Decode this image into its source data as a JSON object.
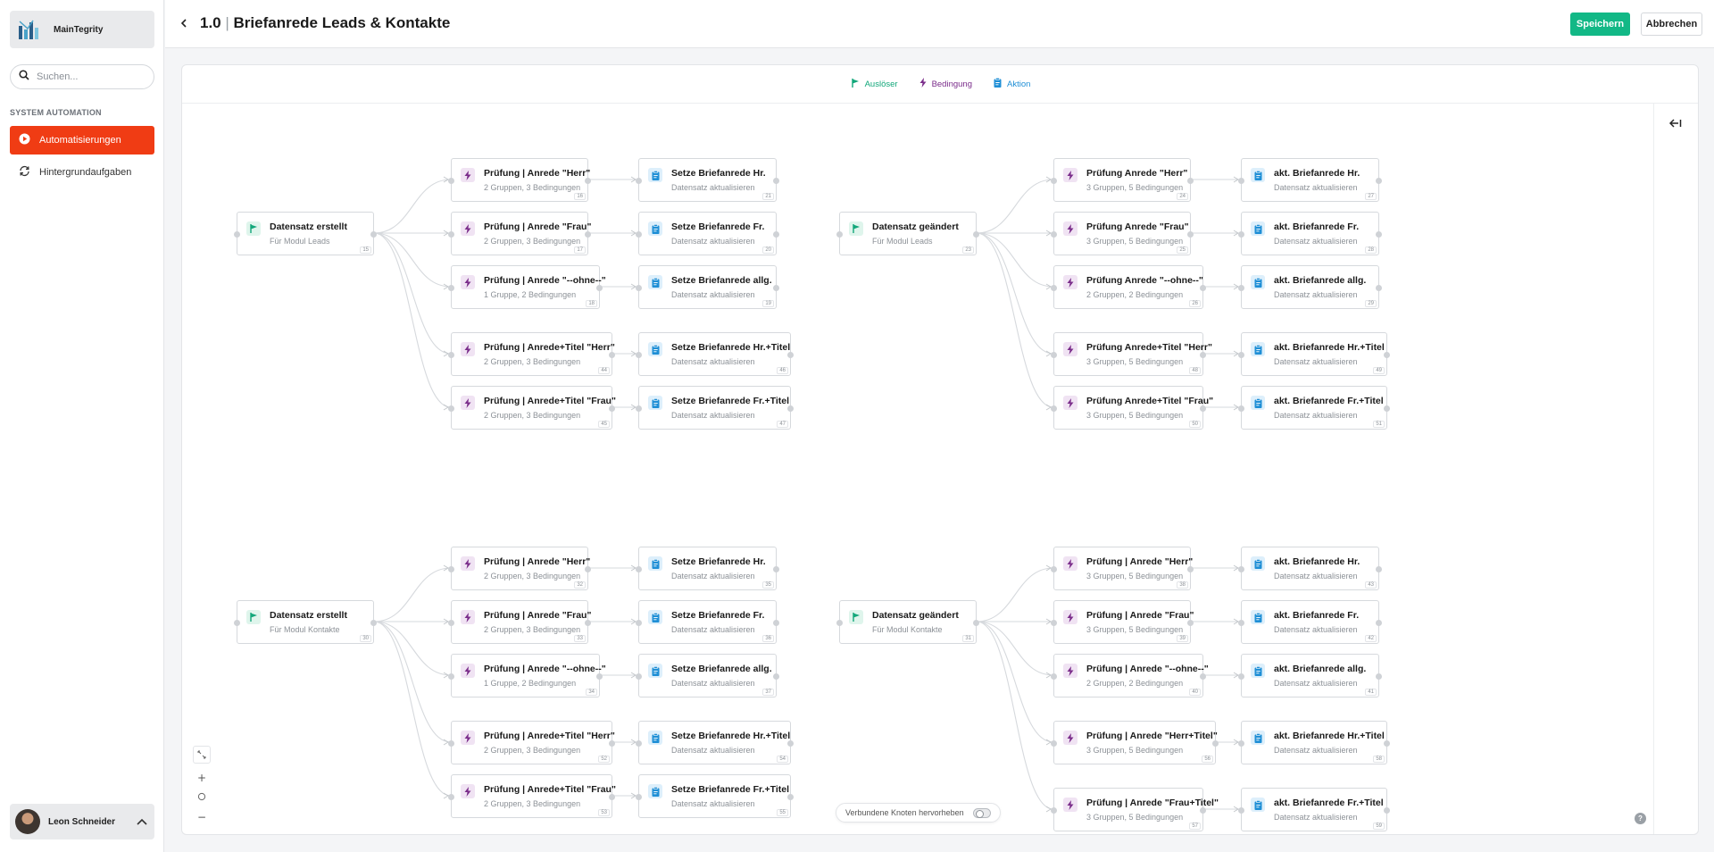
{
  "sidebar": {
    "brand": "MainTegrity",
    "search_placeholder": "Suchen...",
    "section": "SYSTEM AUTOMATION",
    "items": [
      {
        "label": "Automatisierungen",
        "active": true,
        "icon": "play-circle-icon"
      },
      {
        "label": "Hintergrundaufgaben",
        "active": false,
        "icon": "refresh-icon"
      }
    ],
    "user": "Leon Schneider"
  },
  "header": {
    "version": "1.0",
    "separator": "|",
    "title": "Briefanrede Leads & Kontakte",
    "save": "Speichern",
    "cancel": "Abbrechen"
  },
  "legend": {
    "trigger": "Auslöser",
    "condition": "Bedingung",
    "action": "Aktion"
  },
  "colors": {
    "accent": "#f03c14",
    "save": "#12b886",
    "trigger": "#12a77a",
    "condition": "#7a2c8a",
    "action": "#1f8fd6"
  },
  "highlight_label": "Verbundene Knoten hervorheben",
  "help": "?",
  "groups": [
    {
      "trigger": {
        "title": "Datensatz erstellt",
        "sub": "Für Modul Leads",
        "id": "15"
      },
      "branches": [
        {
          "cond": {
            "title": "Prüfung | Anrede \"Herr\"",
            "sub": "2 Gruppen, 3 Bedingungen",
            "id": "16"
          },
          "action": {
            "title": "Setze Briefanrede Hr.",
            "sub": "Datensatz aktualisieren",
            "id": "21"
          }
        },
        {
          "cond": {
            "title": "Prüfung | Anrede \"Frau\"",
            "sub": "2 Gruppen, 3 Bedingungen",
            "id": "17"
          },
          "action": {
            "title": "Setze Briefanrede Fr.",
            "sub": "Datensatz aktualisieren",
            "id": "20"
          }
        },
        {
          "cond": {
            "title": "Prüfung | Anrede \"--ohne--\"",
            "sub": "1 Gruppe, 2 Bedingungen",
            "id": "18"
          },
          "action": {
            "title": "Setze Briefanrede allg.",
            "sub": "Datensatz aktualisieren",
            "id": "19"
          }
        },
        {
          "cond": {
            "title": "Prüfung | Anrede+Titel \"Herr\"",
            "sub": "2 Gruppen, 3 Bedingungen",
            "id": "44"
          },
          "action": {
            "title": "Setze Briefanrede Hr.+Titel",
            "sub": "Datensatz aktualisieren",
            "id": "46"
          }
        },
        {
          "cond": {
            "title": "Prüfung | Anrede+Titel \"Frau\"",
            "sub": "2 Gruppen, 3 Bedingungen",
            "id": "45"
          },
          "action": {
            "title": "Setze Briefanrede Fr.+Titel",
            "sub": "Datensatz aktualisieren",
            "id": "47"
          }
        }
      ]
    },
    {
      "trigger": {
        "title": "Datensatz geändert",
        "sub": "Für Modul Leads",
        "id": "23"
      },
      "branches": [
        {
          "cond": {
            "title": "Prüfung Anrede \"Herr\"",
            "sub": "3 Gruppen, 5 Bedingungen",
            "id": "24"
          },
          "action": {
            "title": "akt. Briefanrede Hr.",
            "sub": "Datensatz aktualisieren",
            "id": "27"
          }
        },
        {
          "cond": {
            "title": "Prüfung Anrede \"Frau\"",
            "sub": "3 Gruppen, 5 Bedingungen",
            "id": "25"
          },
          "action": {
            "title": "akt. Briefanrede Fr.",
            "sub": "Datensatz aktualisieren",
            "id": "28"
          }
        },
        {
          "cond": {
            "title": "Prüfung Anrede \"--ohne--\"",
            "sub": "2 Gruppen, 2 Bedingungen",
            "id": "26"
          },
          "action": {
            "title": "akt. Briefanrede allg.",
            "sub": "Datensatz aktualisieren",
            "id": "29"
          }
        },
        {
          "cond": {
            "title": "Prüfung Anrede+Titel \"Herr\"",
            "sub": "3 Gruppen, 5 Bedingungen",
            "id": "48"
          },
          "action": {
            "title": "akt. Briefanrede Hr.+Titel",
            "sub": "Datensatz aktualisieren",
            "id": "49"
          }
        },
        {
          "cond": {
            "title": "Prüfung Anrede+Titel \"Frau\"",
            "sub": "3 Gruppen, 5 Bedingungen",
            "id": "50"
          },
          "action": {
            "title": "akt. Briefanrede Fr.+Titel",
            "sub": "Datensatz aktualisieren",
            "id": "51"
          }
        }
      ]
    },
    {
      "trigger": {
        "title": "Datensatz erstellt",
        "sub": "Für Modul Kontakte",
        "id": "30"
      },
      "branches": [
        {
          "cond": {
            "title": "Prüfung | Anrede \"Herr\"",
            "sub": "2 Gruppen, 3 Bedingungen",
            "id": "32"
          },
          "action": {
            "title": "Setze Briefanrede Hr.",
            "sub": "Datensatz aktualisieren",
            "id": "35"
          }
        },
        {
          "cond": {
            "title": "Prüfung | Anrede \"Frau\"",
            "sub": "2 Gruppen, 3 Bedingungen",
            "id": "33"
          },
          "action": {
            "title": "Setze Briefanrede Fr.",
            "sub": "Datensatz aktualisieren",
            "id": "36"
          }
        },
        {
          "cond": {
            "title": "Prüfung | Anrede \"--ohne--\"",
            "sub": "1 Gruppe, 2 Bedingungen",
            "id": "34"
          },
          "action": {
            "title": "Setze Briefanrede allg.",
            "sub": "Datensatz aktualisieren",
            "id": "37"
          }
        },
        {
          "cond": {
            "title": "Prüfung | Anrede+Titel \"Herr\"",
            "sub": "2 Gruppen, 3 Bedingungen",
            "id": "52"
          },
          "action": {
            "title": "Setze Briefanrede Hr.+Titel",
            "sub": "Datensatz aktualisieren",
            "id": "54"
          }
        },
        {
          "cond": {
            "title": "Prüfung | Anrede+Titel \"Frau\"",
            "sub": "2 Gruppen, 3 Bedingungen",
            "id": "53"
          },
          "action": {
            "title": "Setze Briefanrede Fr.+Titel",
            "sub": "Datensatz aktualisieren",
            "id": "55"
          }
        }
      ]
    },
    {
      "trigger": {
        "title": "Datensatz geändert",
        "sub": "Für Modul Kontakte",
        "id": "31"
      },
      "branches": [
        {
          "cond": {
            "title": "Prüfung | Anrede \"Herr\"",
            "sub": "3 Gruppen, 5 Bedingungen",
            "id": "38"
          },
          "action": {
            "title": "akt. Briefanrede Hr.",
            "sub": "Datensatz aktualisieren",
            "id": "43"
          }
        },
        {
          "cond": {
            "title": "Prüfung | Anrede \"Frau\"",
            "sub": "3 Gruppen, 5 Bedingungen",
            "id": "39"
          },
          "action": {
            "title": "akt. Briefanrede Fr.",
            "sub": "Datensatz aktualisieren",
            "id": "42"
          }
        },
        {
          "cond": {
            "title": "Prüfung | Anrede \"--ohne--\"",
            "sub": "2 Gruppen, 2 Bedingungen",
            "id": "40"
          },
          "action": {
            "title": "akt. Briefanrede allg.",
            "sub": "Datensatz aktualisieren",
            "id": "41"
          }
        },
        {
          "cond": {
            "title": "Prüfung | Anrede \"Herr+Titel\"",
            "sub": "3 Gruppen, 5 Bedingungen",
            "id": "56"
          },
          "action": {
            "title": "akt. Briefanrede Hr.+Titel",
            "sub": "Datensatz aktualisieren",
            "id": "58"
          }
        },
        {
          "cond": {
            "title": "Prüfung | Anrede \"Frau+Titel\"",
            "sub": "3 Gruppen, 5 Bedingungen",
            "id": "57"
          },
          "action": {
            "title": "akt. Briefanrede Fr.+Titel",
            "sub": "Datensatz aktualisieren",
            "id": "59"
          }
        }
      ]
    }
  ]
}
